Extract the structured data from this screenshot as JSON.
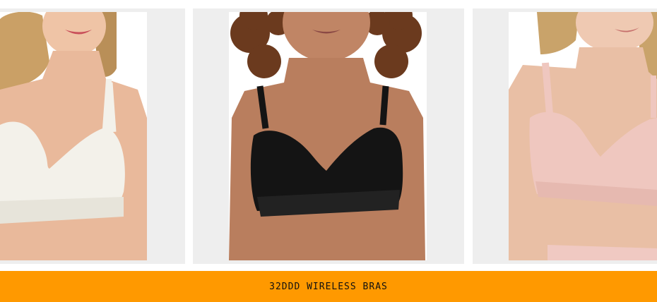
{
  "banner": {
    "label": "32DDD WIRELESS BRAS",
    "color": "#ff9900"
  },
  "products": [
    {
      "name": "product-white-bra",
      "bra_color": "#f3f1ea",
      "skin_color": "#e9b99b",
      "hair_color": "#caa066"
    },
    {
      "name": "product-black-bra",
      "bra_color": "#141414",
      "skin_color": "#b97e5e",
      "hair_color": "#6b3a1e"
    },
    {
      "name": "product-blush-bra",
      "bra_color": "#efc7bf",
      "skin_color": "#e9bfa5",
      "hair_color": "#c9a36a"
    }
  ]
}
